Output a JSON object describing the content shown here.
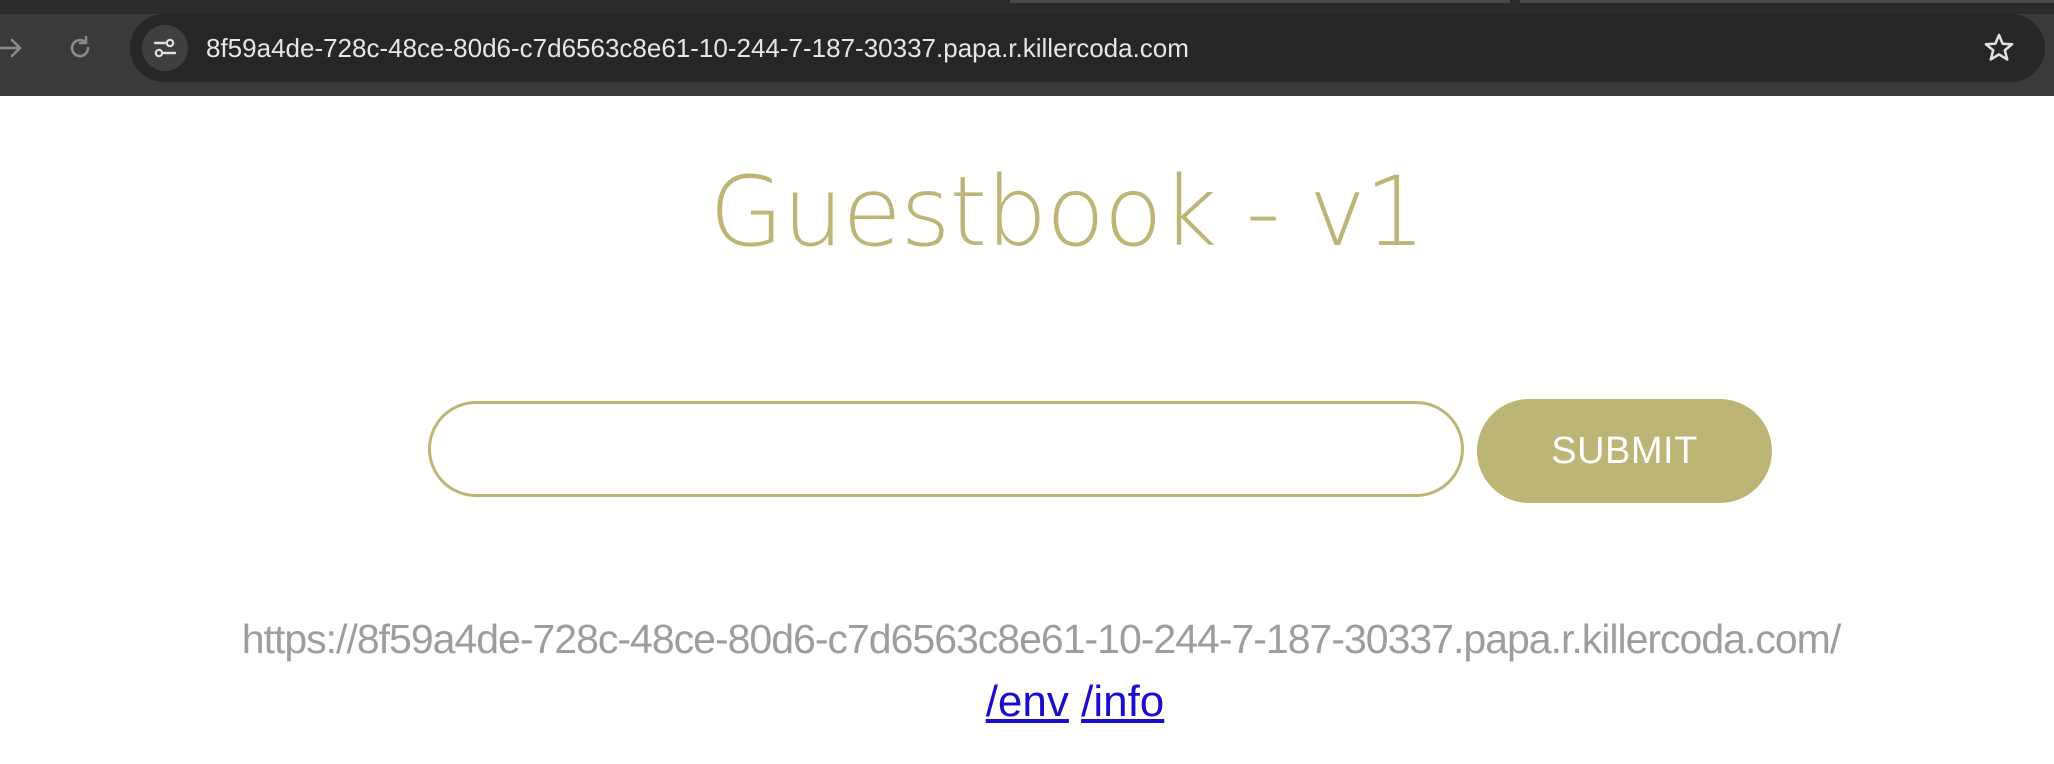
{
  "browser": {
    "url": "8f59a4de-728c-48ce-80d6-c7d6563c8e61-10-244-7-187-30337.papa.r.killercoda.com",
    "icons": {
      "forward": "forward-arrow-icon",
      "reload": "reload-icon",
      "site_info": "site-settings-icon",
      "bookmark": "star-icon"
    }
  },
  "page": {
    "title": "Guestbook - v1",
    "input": {
      "value": "",
      "placeholder": ""
    },
    "submit_label": "SUBMIT",
    "host": "https://8f59a4de-728c-48ce-80d6-c7d6563c8e61-10-244-7-187-30337.papa.r.killercoda.com/",
    "links": [
      {
        "label": "/env"
      },
      {
        "label": "/info"
      }
    ]
  },
  "colors": {
    "accent": "#bdb576",
    "toolbar": "#3a3a3a",
    "omnibox": "#262626",
    "host_text": "#9d9d9d",
    "link": "#1a0dcc"
  }
}
